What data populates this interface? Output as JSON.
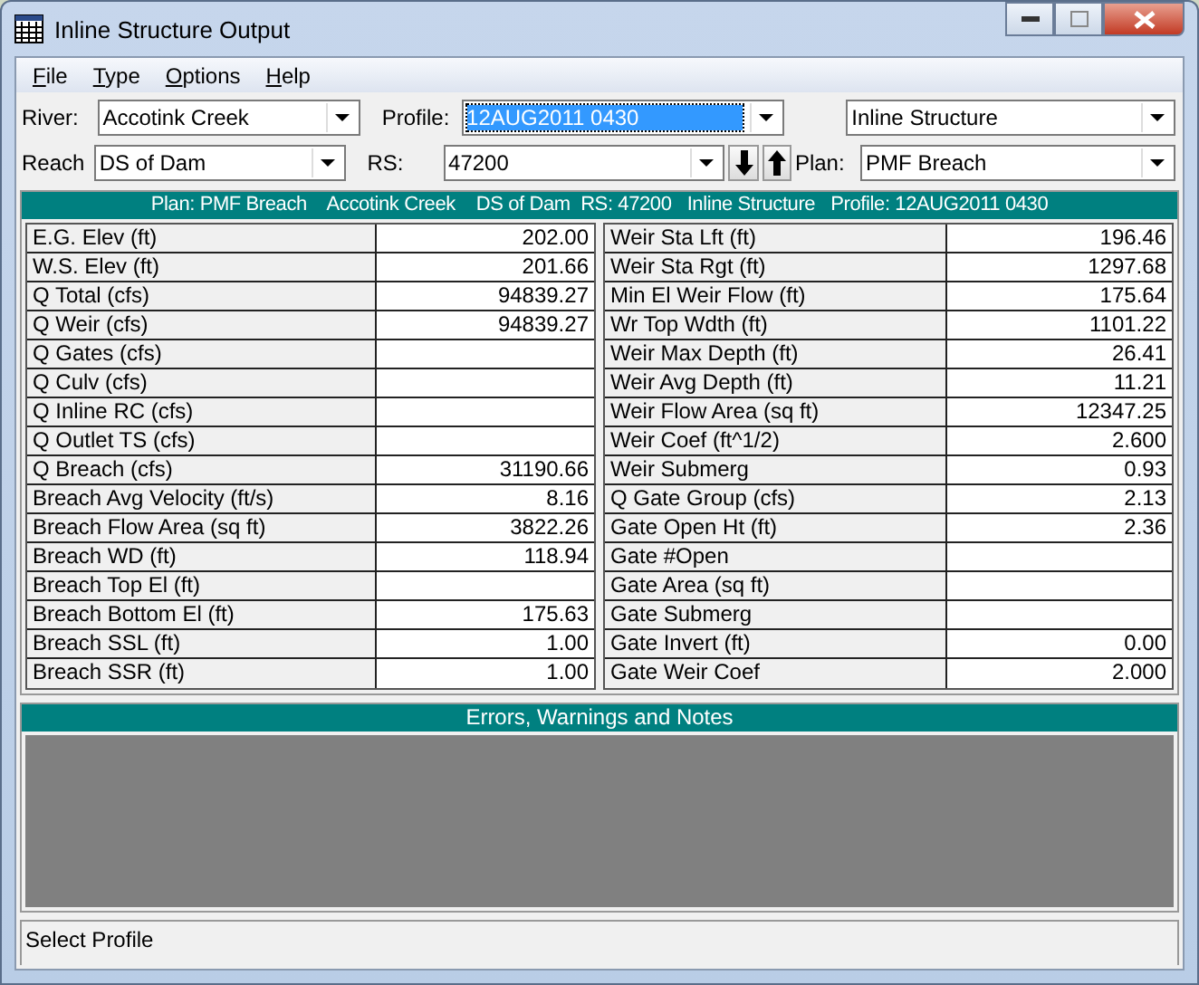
{
  "window": {
    "title": "Inline Structure Output"
  },
  "menu": [
    "File",
    "Type",
    "Options",
    "Help"
  ],
  "selectors": {
    "river": {
      "label": "River:",
      "value": "Accotink Creek"
    },
    "profile": {
      "label": "Profile:",
      "value": "12AUG2011 0430",
      "highlighted": true
    },
    "type": {
      "value": "Inline Structure"
    },
    "reach": {
      "label": "Reach",
      "value": "DS of Dam"
    },
    "rs": {
      "label": "RS:",
      "value": "47200"
    },
    "plan": {
      "label": "Plan:",
      "value": "PMF Breach"
    }
  },
  "header": "Plan: PMF Breach    Accotink Creek    DS of Dam  RS: 47200   Inline Structure   Profile: 12AUG2011 0430",
  "table_left": [
    {
      "label": "E.G. Elev (ft)",
      "value": "202.00"
    },
    {
      "label": "W.S. Elev (ft)",
      "value": "201.66"
    },
    {
      "label": "Q Total (cfs)",
      "value": "94839.27"
    },
    {
      "label": "Q Weir (cfs)",
      "value": "94839.27"
    },
    {
      "label": "Q Gates (cfs)"
    },
    {
      "label": "Q Culv (cfs)"
    },
    {
      "label": "Q Inline RC (cfs)"
    },
    {
      "label": "Q Outlet TS (cfs)"
    },
    {
      "label": "Q Breach (cfs)",
      "value": "31190.66"
    },
    {
      "label": "Breach Avg Velocity (ft/s)",
      "value": "8.16"
    },
    {
      "label": "Breach Flow Area (sq ft)",
      "value": "3822.26"
    },
    {
      "label": "Breach WD (ft)",
      "value": "118.94"
    },
    {
      "label": "Breach Top El (ft)"
    },
    {
      "label": "Breach Bottom El (ft)",
      "value": "175.63"
    },
    {
      "label": "Breach SSL (ft)",
      "value": "1.00"
    },
    {
      "label": "Breach SSR (ft)",
      "value": "1.00"
    }
  ],
  "table_right": [
    {
      "label": "Weir Sta Lft (ft)",
      "value": "196.46"
    },
    {
      "label": "Weir Sta Rgt (ft)",
      "value": "1297.68"
    },
    {
      "label": "Min El Weir Flow (ft)",
      "value": "175.64"
    },
    {
      "label": "Wr Top Wdth (ft)",
      "value": "1101.22"
    },
    {
      "label": "Weir Max Depth (ft)",
      "value": "26.41"
    },
    {
      "label": "Weir Avg Depth (ft)",
      "value": "11.21"
    },
    {
      "label": "Weir Flow Area (sq ft)",
      "value": "12347.25"
    },
    {
      "label": "Weir Coef (ft^1/2)",
      "value": "2.600"
    },
    {
      "label": "Weir Submerg",
      "value": "0.93"
    },
    {
      "label": "Q Gate Group (cfs)",
      "value": "2.13"
    },
    {
      "label": "Gate Open Ht (ft)",
      "value": "2.36"
    },
    {
      "label": "Gate #Open"
    },
    {
      "label": "Gate Area (sq ft)"
    },
    {
      "label": "Gate Submerg"
    },
    {
      "label": "Gate Invert (ft)",
      "value": "0.00"
    },
    {
      "label": "Gate Weir Coef",
      "value": "2.000"
    }
  ],
  "errors": {
    "title": "Errors, Warnings and Notes"
  },
  "status_bar": "Select Profile"
}
